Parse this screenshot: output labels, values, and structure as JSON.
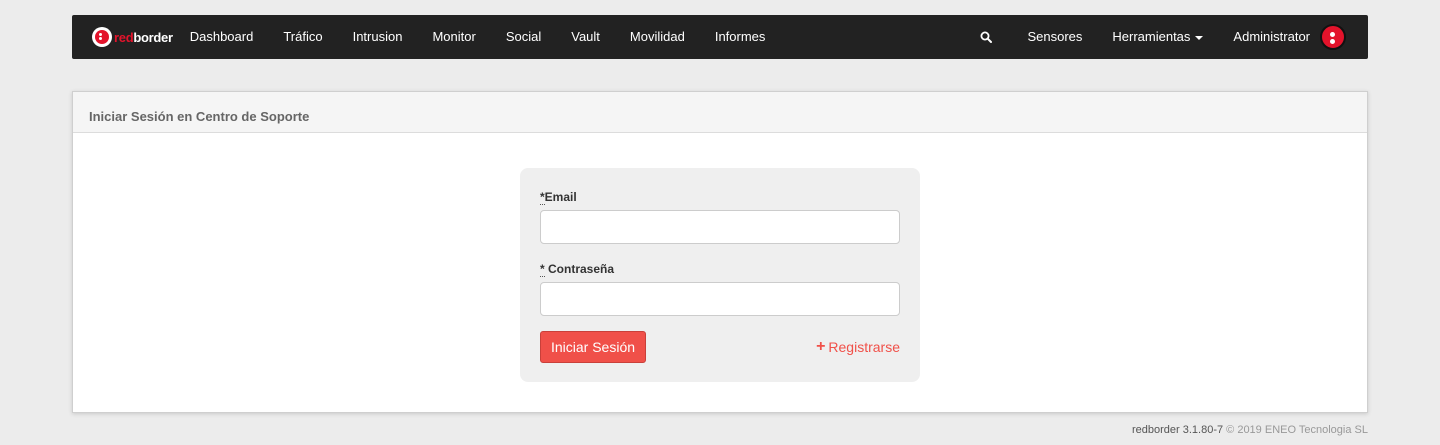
{
  "brand": {
    "red_part": "red",
    "white_part": "border"
  },
  "nav": {
    "items": [
      "Dashboard",
      "Tráfico",
      "Intrusion",
      "Monitor",
      "Social",
      "Vault",
      "Movilidad",
      "Informes"
    ],
    "sensores": "Sensores",
    "herramientas": "Herramientas",
    "user": "Administrator"
  },
  "panel": {
    "title": "Iniciar Sesión en Centro de Soporte"
  },
  "form": {
    "email_req": "*",
    "email_label": "Email",
    "email_value": "",
    "password_req": "*",
    "password_label": " Contraseña",
    "password_value": "",
    "submit_label": "Iniciar Sesión",
    "register_label": "Registrarse"
  },
  "footer": {
    "version": "redborder 3.1.80-7",
    "copyright": " © 2019 ENEO Tecnologia SL"
  },
  "colors": {
    "accent": "#f05049",
    "brand_red": "#e3132b",
    "navbar": "#222222"
  }
}
